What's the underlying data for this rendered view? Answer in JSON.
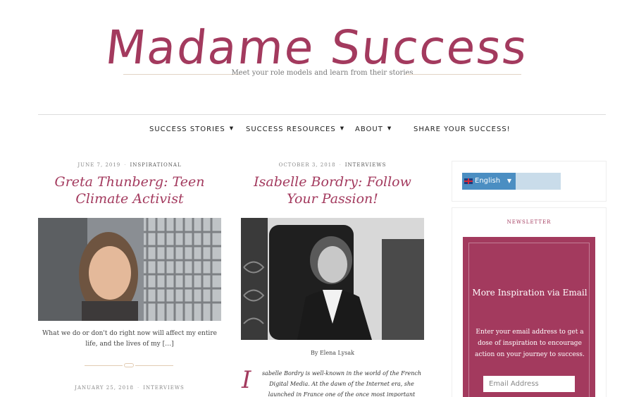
{
  "site": {
    "title": "Madame Success",
    "tagline": "Meet your role models and learn from their stories"
  },
  "nav": {
    "items": [
      {
        "label": "SUCCESS STORIES",
        "has_dropdown": true
      },
      {
        "label": "SUCCESS RESOURCES",
        "has_dropdown": true
      },
      {
        "label": "ABOUT",
        "has_dropdown": true
      },
      {
        "label": "SHARE YOUR SUCCESS!",
        "has_dropdown": false
      }
    ]
  },
  "posts": [
    {
      "date": "JUNE 7, 2019",
      "category": "INSPIRATIONAL",
      "title": "Greta Thunberg: Teen Climate Activist",
      "excerpt": "What we do or don't do right now will affect my entire life, and the lives of my […]"
    },
    {
      "date": "OCTOBER 3, 2018",
      "category": "INTERVIEWS",
      "title": "Isabelle Bordry: Follow Your Passion!",
      "byline": "By Elena Lysak",
      "dropcap": "I",
      "body": "sabelle Bordry is well-known in the world of the French Digital Media. At the dawn of the Internet era, she launched in France one of the once most important search engines, Yahoo! Directory."
    },
    {
      "date": "JANUARY 25, 2018",
      "category": "INTERVIEWS"
    }
  ],
  "sidebar": {
    "language": {
      "label": "English",
      "arrow": "▼"
    },
    "newsletter": {
      "heading": "NEWSLETTER",
      "title": "More Inspiration via Email",
      "text": "Enter your email address to get a dose of inspiration to encourage action on your journey to success.",
      "input_placeholder": "Email Address"
    }
  },
  "colors": {
    "accent": "#a33a5e",
    "language_button": "#4b8ec2",
    "language_bar": "#c9dcea"
  }
}
